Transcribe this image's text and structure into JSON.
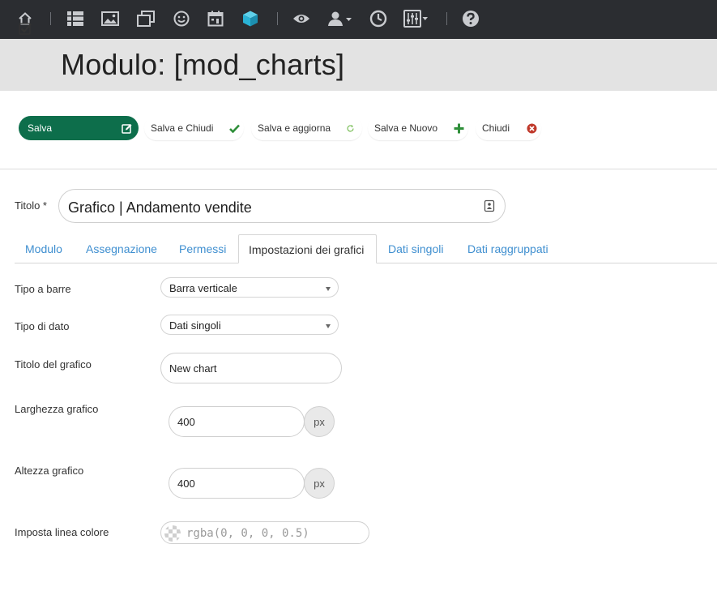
{
  "navbar": {
    "icons": [
      "home-icon",
      "list-icon",
      "image-icon",
      "copy-icon",
      "smiley-icon",
      "calendar-icon",
      "cube-icon",
      "eye-icon",
      "user-dropdown-icon",
      "clock-icon",
      "settings-dropdown-icon",
      "help-icon"
    ],
    "colors": {
      "background": "#2b2d31",
      "icon": "#c9cbcf",
      "active_icon": "#2ab3d6"
    }
  },
  "header": {
    "title": "Modulo: [mod_charts]",
    "icon": "checkbox-icon"
  },
  "toolbar": {
    "save_label": "Salva",
    "save_close_label": "Salva e Chiudi",
    "save_refresh_label": "Salva e aggiorna",
    "save_new_label": "Salva e Nuovo",
    "close_label": "Chiudi",
    "colors": {
      "primary": "#0d6e4b",
      "check": "#2f8f3a",
      "plus": "#2f8f3a",
      "refresh": "#7bbf5a",
      "close": "#c0392b"
    }
  },
  "title_field": {
    "label": "Titolo *",
    "value": "Grafico | Andamento vendite"
  },
  "tabs": [
    {
      "label": "Modulo"
    },
    {
      "label": "Assegnazione"
    },
    {
      "label": "Permessi"
    },
    {
      "label": "Impostazioni dei grafici",
      "active": true
    },
    {
      "label": "Dati singoli"
    },
    {
      "label": "Dati raggruppati"
    }
  ],
  "form": {
    "bar_type": {
      "label": "Tipo a barre",
      "value": "Barra verticale"
    },
    "data_type": {
      "label": "Tipo di dato",
      "value": "Dati singoli"
    },
    "chart_title": {
      "label": "Titolo del grafico",
      "value": "New chart"
    },
    "chart_width": {
      "label": "Larghezza grafico",
      "value": "400",
      "unit": "px"
    },
    "chart_height": {
      "label": "Altezza grafico",
      "value": "400",
      "unit": "px"
    },
    "line_color": {
      "label": "Imposta linea colore",
      "placeholder": "rgba(0, 0, 0, 0.5)"
    }
  }
}
